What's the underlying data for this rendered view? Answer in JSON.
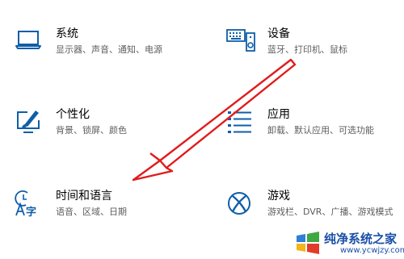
{
  "tiles": [
    {
      "title": "系统",
      "desc": "显示器、声音、通知、电源",
      "icon": "laptop-icon"
    },
    {
      "title": "设备",
      "desc": "蓝牙、打印机、鼠标",
      "icon": "keyboard-speaker-icon"
    },
    {
      "title": "个性化",
      "desc": "背景、锁屏、颜色",
      "icon": "paint-monitor-icon"
    },
    {
      "title": "应用",
      "desc": "卸载、默认应用、可选功能",
      "icon": "app-list-icon"
    },
    {
      "title": "时间和语言",
      "desc": "语音、区域、日期",
      "icon": "time-language-icon"
    },
    {
      "title": "游戏",
      "desc": "游戏栏、DVR、广播、游戏模式",
      "icon": "xbox-icon"
    }
  ],
  "watermark": {
    "text": "纯净系统之家",
    "url": "www.ycwjzy.com"
  },
  "colors": {
    "icon_blue": "#0f5ea8",
    "arrow_red": "#e21b1b",
    "desc_gray": "#5d5d5d"
  }
}
